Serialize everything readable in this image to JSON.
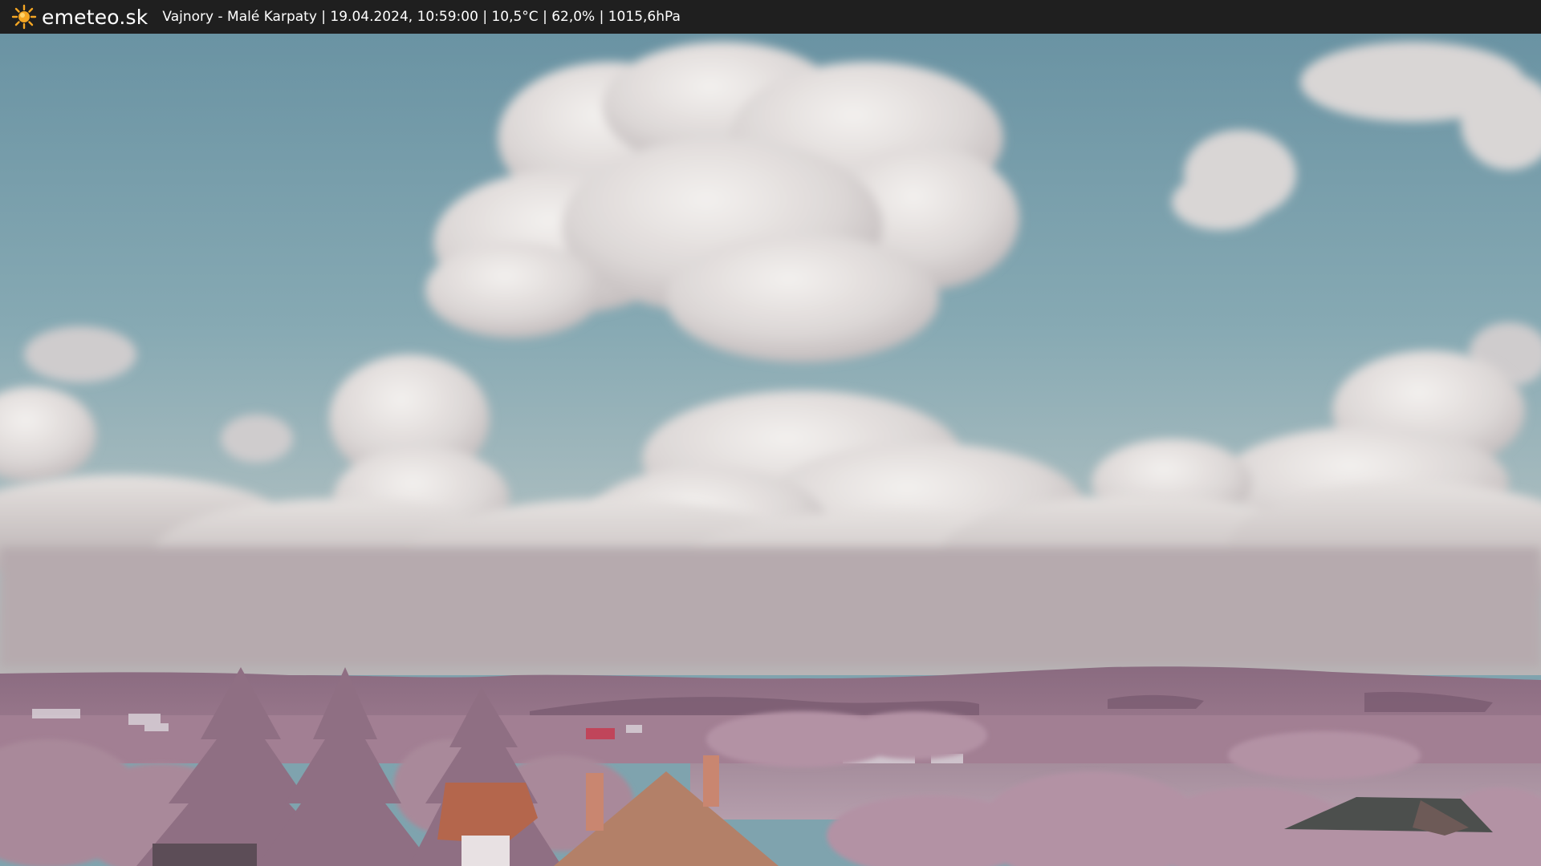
{
  "header": {
    "logo_text": "emeteo.sk",
    "logo_icon": "sun-icon",
    "caption": "Vajnory - Malé Karpaty | 19.04.2024, 10:59:00 | 10,5°C | 62,0% | 1015,6hPa"
  },
  "image": {
    "subject": "webcam-landscape"
  },
  "colors": {
    "header_bg": "#1f1f1f",
    "header_text": "#ffffff",
    "sun": "#f5a623",
    "sky_top": "#6e99a8",
    "sky_bottom": "#a7bcc0",
    "hills": "#8e6d83",
    "foliage": "#b08a9e",
    "roof": "#b46a4e"
  }
}
